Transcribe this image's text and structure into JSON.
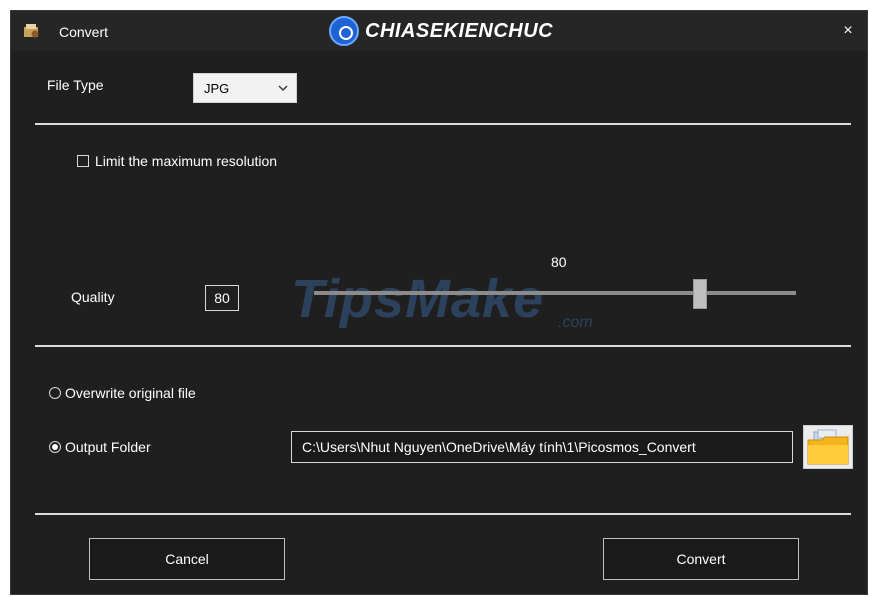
{
  "window": {
    "title": "Convert",
    "close_glyph": "×",
    "watermark_top": "CHIASEKIENCHUC"
  },
  "file_type": {
    "label": "File Type",
    "selected": "JPG"
  },
  "resolution": {
    "checkbox_label": "Limit the maximum resolution",
    "checked": false
  },
  "quality": {
    "label": "Quality",
    "value": "80",
    "slider_value_label": "80",
    "slider_fraction": 0.8
  },
  "watermark_mid": {
    "main": "TipsMake",
    "suffix": ".com"
  },
  "output": {
    "overwrite_label": "Overwrite original file",
    "output_folder_label": "Output Folder",
    "path_value": "C:\\Users\\Nhut Nguyen\\OneDrive\\Máy tính\\1\\Picosmos_Convert",
    "selected_option": "output_folder"
  },
  "buttons": {
    "cancel": "Cancel",
    "convert": "Convert"
  },
  "colors": {
    "window_bg": "#1f1f1f",
    "titlebar_bg": "#262626",
    "text": "#ffffff",
    "divider": "#dcdcdc",
    "accent_blue": "#1e63d6"
  },
  "icons": [
    "app-icon",
    "close-icon",
    "chevron-down-icon",
    "folder-icon"
  ]
}
